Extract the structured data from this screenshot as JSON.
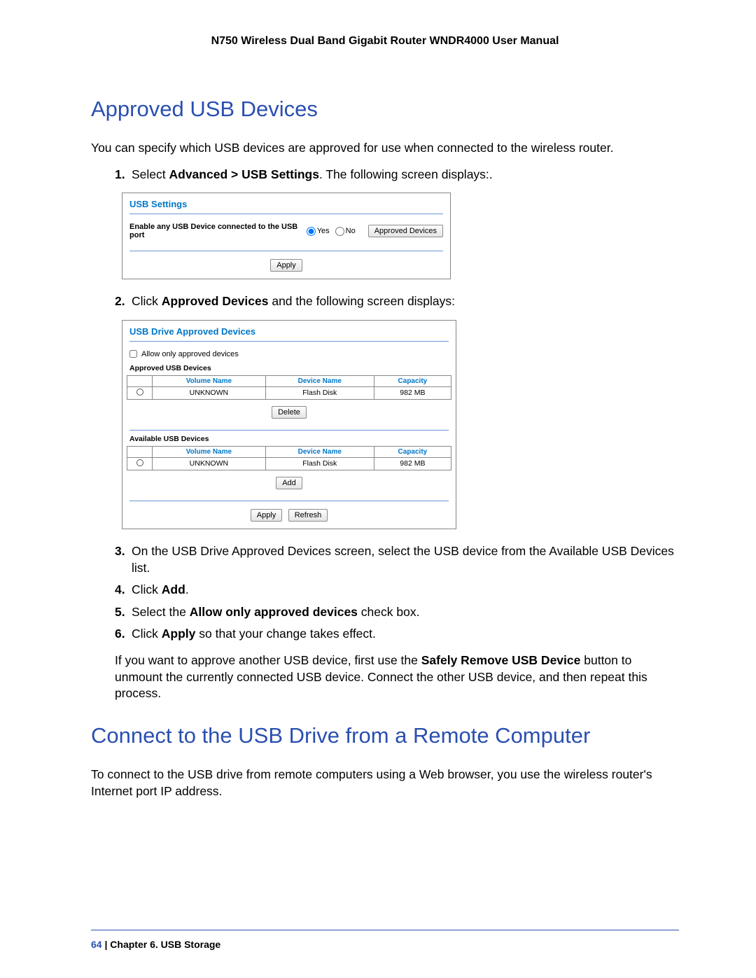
{
  "header": {
    "title": "N750 Wireless Dual Band Gigabit Router WNDR4000 User Manual"
  },
  "section1": {
    "heading": "Approved USB Devices",
    "intro": "You can specify which USB devices are approved for use when connected to the wireless router.",
    "steps": {
      "s1_num": "1.",
      "s1_a": "Select ",
      "s1_b": "Advanced > USB Settings",
      "s1_c": ". The following screen displays:.",
      "s2_num": "2.",
      "s2_a": "Click ",
      "s2_b": "Approved Devices",
      "s2_c": " and the following screen displays:",
      "s3_num": "3.",
      "s3": "On the USB Drive Approved Devices screen, select the USB device from the Available USB Devices list.",
      "s4_num": "4.",
      "s4_a": "Click ",
      "s4_b": "Add",
      "s4_c": ".",
      "s5_num": "5.",
      "s5_a": "Select the ",
      "s5_b": "Allow only approved devices",
      "s5_c": " check box.",
      "s6_num": "6.",
      "s6_a": "Click ",
      "s6_b": "Apply",
      "s6_c": " so that your change takes effect."
    },
    "closing_a": "If you want to approve another USB device, first use the ",
    "closing_b": "Safely Remove USB Device",
    "closing_c": " button to unmount the currently connected USB device. Connect the other USB device, and then repeat this process."
  },
  "panel1": {
    "title": "USB Settings",
    "enable_label": "Enable any USB Device connected to the USB port",
    "yes": "Yes",
    "no": "No",
    "approved_btn": "Approved Devices",
    "apply_btn": "Apply"
  },
  "panel2": {
    "title": "USB Drive Approved Devices",
    "allow_label": "Allow only approved devices",
    "approved_heading": "Approved USB Devices",
    "available_heading": "Available USB Devices",
    "th_vol": "Volume Name",
    "th_dev": "Device Name",
    "th_cap": "Capacity",
    "row_vol": "UNKNOWN",
    "row_dev": "Flash Disk",
    "row_cap": "982 MB",
    "delete_btn": "Delete",
    "add_btn": "Add",
    "apply_btn": "Apply",
    "refresh_btn": "Refresh"
  },
  "section2": {
    "heading": "Connect to the USB Drive from a Remote Computer",
    "body": "To connect to the USB drive from remote computers using a Web browser, you use the wireless router's Internet port IP address."
  },
  "footer": {
    "page_num": "64",
    "sep": "   |   ",
    "chapter": "Chapter 6.  USB Storage"
  }
}
